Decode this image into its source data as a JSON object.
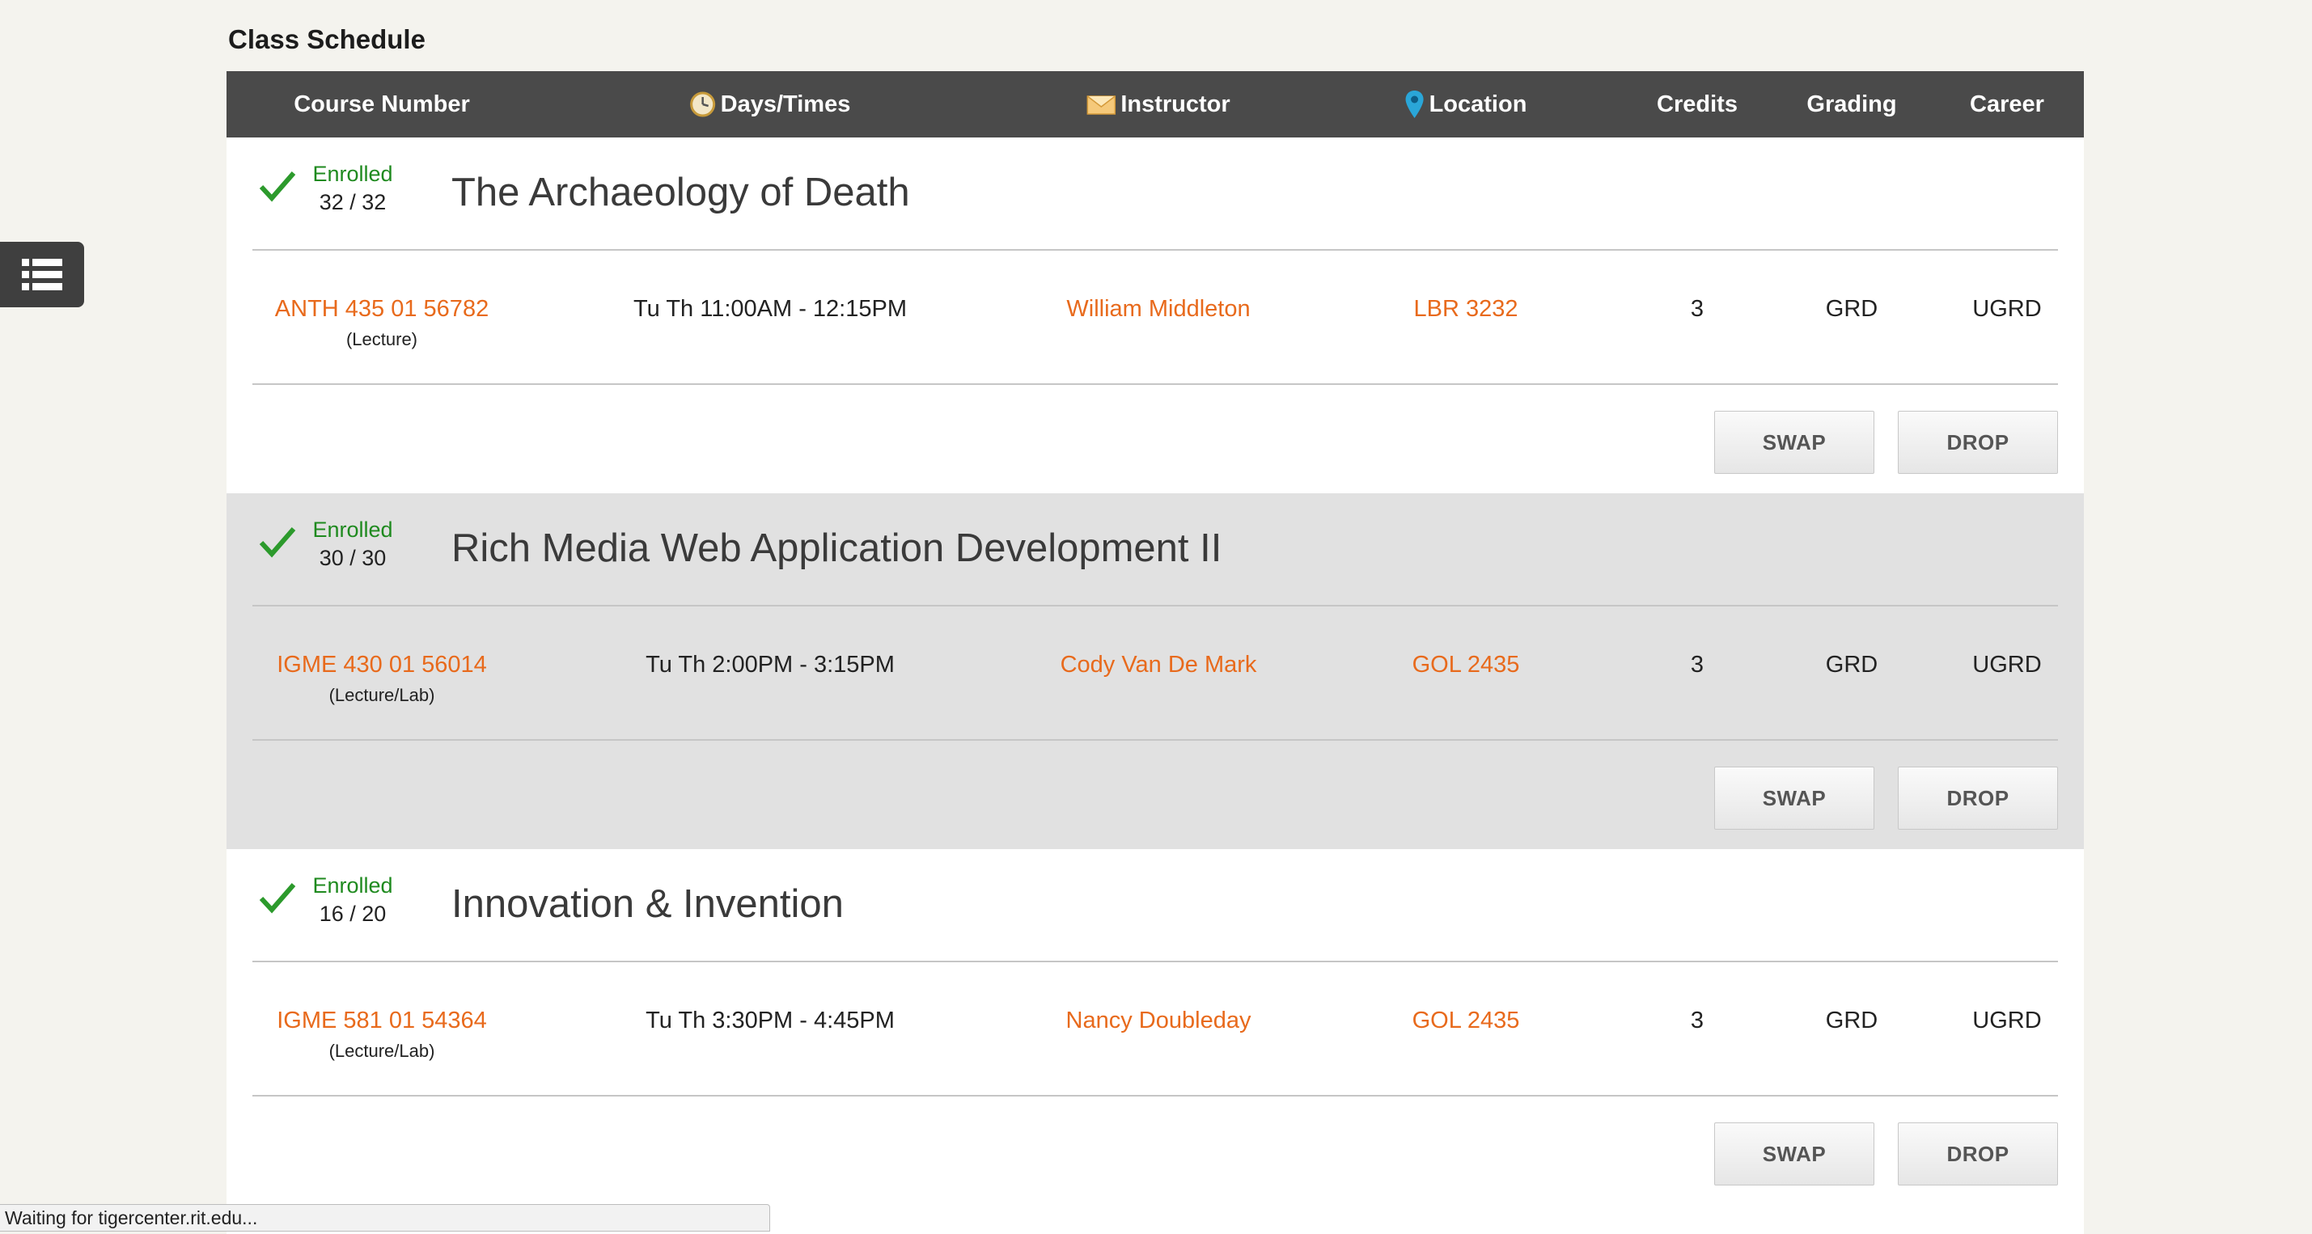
{
  "page": {
    "title": "Class Schedule"
  },
  "table": {
    "headers": {
      "course_number": "Course Number",
      "days_times": "Days/Times",
      "instructor": "Instructor",
      "location": "Location",
      "credits": "Credits",
      "grading": "Grading",
      "career": "Career"
    },
    "header_icons": {
      "days_times": "clock-icon",
      "instructor": "envelope-icon",
      "location": "map-pin-icon"
    }
  },
  "courses": [
    {
      "status": "Enrolled",
      "seats": "32 / 32",
      "title": "The Archaeology of Death",
      "course_number": "ANTH 435 01 56782",
      "component": "(Lecture)",
      "days_times": "Tu Th 11:00AM - 12:15PM",
      "instructor": "William Middleton",
      "location": "LBR 3232",
      "credits": "3",
      "grading": "GRD",
      "career": "UGRD",
      "swap_label": "SWAP",
      "drop_label": "DROP"
    },
    {
      "status": "Enrolled",
      "seats": "30 / 30",
      "title": "Rich Media Web Application Development II",
      "course_number": "IGME 430 01 56014",
      "component": "(Lecture/Lab)",
      "days_times": "Tu Th 2:00PM - 3:15PM",
      "instructor": "Cody Van De Mark",
      "location": "GOL 2435",
      "credits": "3",
      "grading": "GRD",
      "career": "UGRD",
      "swap_label": "SWAP",
      "drop_label": "DROP"
    },
    {
      "status": "Enrolled",
      "seats": "16 / 20",
      "title": "Innovation & Invention",
      "course_number": "IGME 581 01 54364",
      "component": "(Lecture/Lab)",
      "days_times": "Tu Th 3:30PM - 4:45PM",
      "instructor": "Nancy Doubleday",
      "location": "GOL 2435",
      "credits": "3",
      "grading": "GRD",
      "career": "UGRD",
      "swap_label": "SWAP",
      "drop_label": "DROP"
    }
  ],
  "side_tab": {
    "icon": "list-icon"
  },
  "status_bar": {
    "text": "Waiting for tigercenter.rit.edu..."
  },
  "colors": {
    "header_bg": "#4a4a4a",
    "link": "#e86a1c",
    "enrolled": "#1f8a1f",
    "alt_row": "#e1e1e1"
  }
}
